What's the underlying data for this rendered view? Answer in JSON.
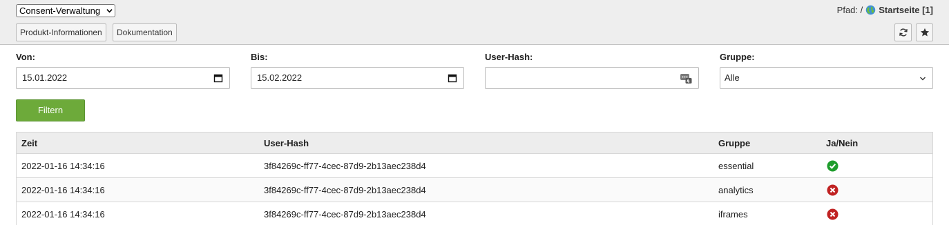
{
  "header": {
    "module_select": "Consent-Verwaltung",
    "buttons": [
      "Produkt-Informationen",
      "Dokumentation"
    ],
    "path_label": "Pfad: /",
    "path_page": "Startseite [1]"
  },
  "filters": {
    "von_label": "Von:",
    "von_value": "15.01.2022",
    "bis_label": "Bis:",
    "bis_value": "15.02.2022",
    "hash_label": "User-Hash:",
    "hash_value": "",
    "gruppe_label": "Gruppe:",
    "gruppe_value": "Alle",
    "submit_label": "Filtern"
  },
  "table": {
    "headers": [
      "Zeit",
      "User-Hash",
      "Gruppe",
      "Ja/Nein"
    ],
    "rows": [
      {
        "zeit": "2022-01-16 14:34:16",
        "hash": "3f84269c-ff77-4cec-87d9-2b13aec238d4",
        "gruppe": "essential",
        "status": "yes"
      },
      {
        "zeit": "2022-01-16 14:34:16",
        "hash": "3f84269c-ff77-4cec-87d9-2b13aec238d4",
        "gruppe": "analytics",
        "status": "no"
      },
      {
        "zeit": "2022-01-16 14:34:16",
        "hash": "3f84269c-ff77-4cec-87d9-2b13aec238d4",
        "gruppe": "iframes",
        "status": "no"
      }
    ]
  },
  "colors": {
    "yes": "#1e9d2c",
    "no": "#c02222",
    "accent": "#6daa3a"
  },
  "icons": {
    "calendar": "calendar-icon",
    "hash": "password-manager-icon",
    "select": "chevron-down-icon",
    "reload": "reload-icon",
    "bookmark": "star-icon",
    "page": "globe-icon"
  }
}
